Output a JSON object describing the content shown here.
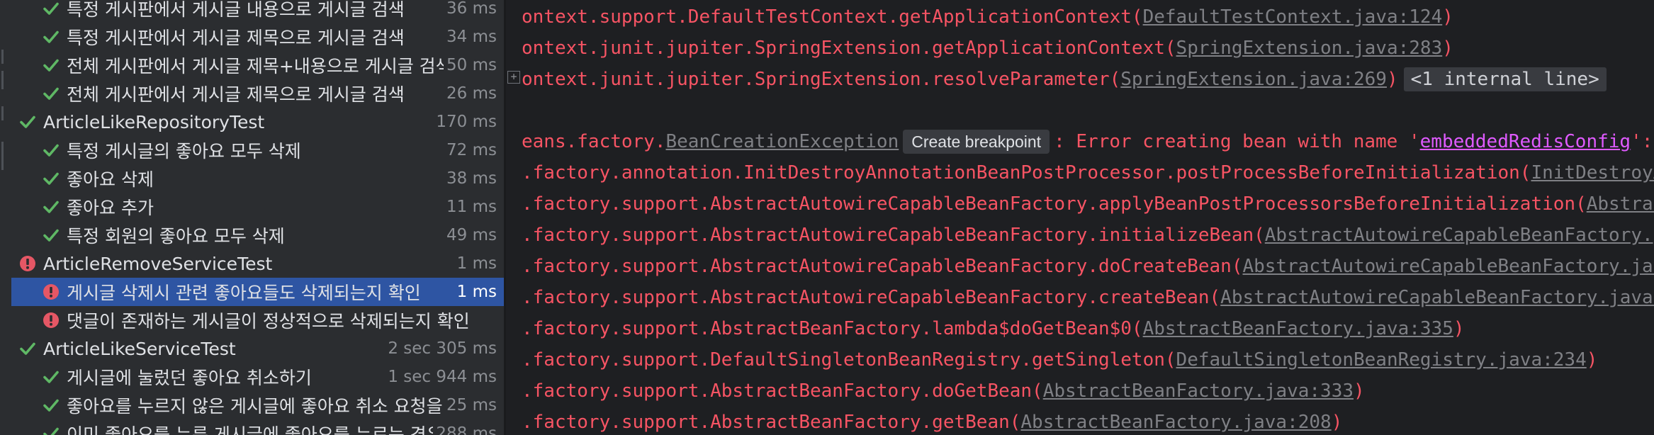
{
  "colors": {
    "pass": "#5fb865",
    "fail": "#e55765",
    "selected": "#2e55a3",
    "error_text": "#f75464"
  },
  "tree": [
    {
      "label": "특정 게시판에서 게시글 내용으로 게시글 검색",
      "duration": "36 ms",
      "status": "passed",
      "level": 2,
      "icon": "check-icon"
    },
    {
      "label": "특정 게시판에서 게시글 제목으로 게시글 검색",
      "duration": "34 ms",
      "status": "passed",
      "level": 2,
      "icon": "check-icon"
    },
    {
      "label": "전체 게시판에서 게시글 제목+내용으로 게시글 검색",
      "duration": "50 ms",
      "status": "passed",
      "level": 2,
      "icon": "check-icon"
    },
    {
      "label": "전체 게시판에서 게시글 제목으로 게시글 검색",
      "duration": "26 ms",
      "status": "passed",
      "level": 2,
      "icon": "check-icon"
    },
    {
      "label": "ArticleLikeRepositoryTest",
      "duration": "170 ms",
      "status": "passed",
      "level": 1,
      "icon": "check-icon"
    },
    {
      "label": "특정 게시글의 좋아요 모두 삭제",
      "duration": "72 ms",
      "status": "passed",
      "level": 2,
      "icon": "check-icon"
    },
    {
      "label": "좋아요 삭제",
      "duration": "38 ms",
      "status": "passed",
      "level": 2,
      "icon": "check-icon"
    },
    {
      "label": "좋아요 추가",
      "duration": "11 ms",
      "status": "passed",
      "level": 2,
      "icon": "check-icon"
    },
    {
      "label": "특정 회원의 좋아요 모두 삭제",
      "duration": "49 ms",
      "status": "passed",
      "level": 2,
      "icon": "check-icon"
    },
    {
      "label": "ArticleRemoveServiceTest",
      "duration": "1 ms",
      "status": "failed",
      "level": 1,
      "icon": "error-icon"
    },
    {
      "label": "게시글 삭제시 관련 좋아요들도 삭제되는지 확인",
      "duration": "1 ms",
      "status": "failed",
      "level": 2,
      "icon": "error-icon",
      "selected": true
    },
    {
      "label": "댓글이 존재하는 게시글이 정상적으로 삭제되는지 확인",
      "duration": "",
      "status": "failed",
      "level": 2,
      "icon": "error-icon"
    },
    {
      "label": "ArticleLikeServiceTest",
      "duration": "2 sec 305 ms",
      "status": "passed",
      "level": 1,
      "icon": "check-icon"
    },
    {
      "label": "게시글에 눌렀던 좋아요 취소하기",
      "duration": "1 sec 944 ms",
      "status": "passed",
      "level": 2,
      "icon": "check-icon"
    },
    {
      "label": "좋아요를 누르지 않은 게시글에 좋아요 취소 요청을 !",
      "duration": "25 ms",
      "status": "passed",
      "level": 2,
      "icon": "check-icon"
    },
    {
      "label": "이미 좋아요를 누른 게시글에 좋아요를 누르는 경우",
      "duration": "288 ms",
      "status": "passed",
      "level": 2,
      "icon": "check-icon"
    }
  ],
  "console": {
    "lines": [
      [
        {
          "t": "ontext.support.DefaultTestContext.getApplicationContext("
        },
        {
          "t": "DefaultTestContext.java:124",
          "link": true
        },
        {
          "t": ")"
        }
      ],
      [
        {
          "t": "ontext.junit.jupiter.SpringExtension.getApplicationContext("
        },
        {
          "t": "SpringExtension.java:283",
          "link": true
        },
        {
          "t": ")"
        }
      ],
      [
        {
          "t": "ontext.junit.jupiter.SpringExtension.resolveParameter("
        },
        {
          "t": "SpringExtension.java:269",
          "link": true
        },
        {
          "t": ")"
        },
        {
          "t": "<1 internal line>",
          "pill": true
        }
      ],
      [],
      [
        {
          "t": "eans.factory."
        },
        {
          "t": "BeanCreationException",
          "link": true
        },
        {
          "t": "Create breakpoint",
          "tip": true
        },
        {
          "t": ": Error creating bean with name '"
        },
        {
          "t": "embeddedRedisConfig",
          "linkpink": true
        },
        {
          "t": "':"
        }
      ],
      [
        {
          "t": ".factory.annotation.InitDestroyAnnotationBeanPostProcessor.postProcessBeforeInitialization("
        },
        {
          "t": "InitDestroyA",
          "link": true
        }
      ],
      [
        {
          "t": ".factory.support.AbstractAutowireCapableBeanFactory.applyBeanPostProcessorsBeforeInitialization("
        },
        {
          "t": "Abstrac",
          "link": true
        }
      ],
      [
        {
          "t": ".factory.support.AbstractAutowireCapableBeanFactory.initializeBean("
        },
        {
          "t": "AbstractAutowireCapableBeanFactory.j",
          "link": true
        }
      ],
      [
        {
          "t": ".factory.support.AbstractAutowireCapableBeanFactory.doCreateBean("
        },
        {
          "t": "AbstractAutowireCapableBeanFactory.jav",
          "link": true
        }
      ],
      [
        {
          "t": ".factory.support.AbstractAutowireCapableBeanFactory.createBean("
        },
        {
          "t": "AbstractAutowireCapableBeanFactory.java:",
          "link": true
        }
      ],
      [
        {
          "t": ".factory.support.AbstractBeanFactory.lambda$doGetBean$0("
        },
        {
          "t": "AbstractBeanFactory.java:335",
          "link": true
        },
        {
          "t": ")"
        }
      ],
      [
        {
          "t": ".factory.support.DefaultSingletonBeanRegistry.getSingleton("
        },
        {
          "t": "DefaultSingletonBeanRegistry.java:234",
          "link": true
        },
        {
          "t": ")"
        }
      ],
      [
        {
          "t": ".factory.support.AbstractBeanFactory.doGetBean("
        },
        {
          "t": "AbstractBeanFactory.java:333",
          "link": true
        },
        {
          "t": ")"
        }
      ],
      [
        {
          "t": ".factory.support.AbstractBeanFactory.getBean("
        },
        {
          "t": "AbstractBeanFactory.java:208",
          "link": true
        },
        {
          "t": ")"
        }
      ]
    ]
  }
}
